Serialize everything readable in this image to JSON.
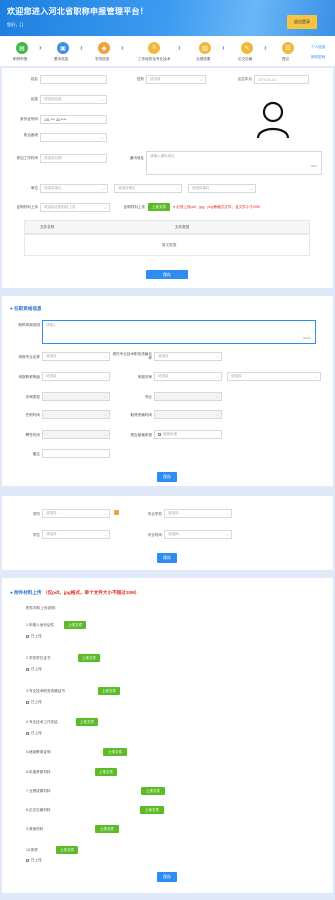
{
  "header": {
    "title": "欢迎您进入河北省职称申报管理平台！",
    "user": "您好，[ ]",
    "button": "退出登录"
  },
  "steps": [
    {
      "label": "职称申报",
      "icon": "doc-icon",
      "color": "#46b54a"
    },
    {
      "label": "基本信息",
      "icon": "user-card-icon",
      "color": "#3f8fe8"
    },
    {
      "label": "学历信息",
      "icon": "education-icon",
      "color": "#f0a23a"
    },
    {
      "label": "工作经历及专业技术",
      "icon": "list-icon",
      "color": "#f0b93a"
    },
    {
      "label": "业绩成果",
      "icon": "chart-icon",
      "color": "#f0b93a"
    },
    {
      "label": "论文论著",
      "icon": "book-icon",
      "color": "#f0b93a"
    },
    {
      "label": "提交",
      "icon": "submit-icon",
      "color": "#f0b93a"
    }
  ],
  "side_links": [
    "个人信息",
    "修改密码"
  ],
  "basic": {
    "name_label": "姓名",
    "name_value": "",
    "gender_label": "性别",
    "gender_value": "请选择",
    "birth_label": "出生年月",
    "birth_value": "1970-01-01",
    "nation_label": "民族",
    "nation_value": "请选择民族",
    "idcard_label": "身份证号码",
    "idcard_value": "131 *** 2A ****",
    "politics_label": "政治面貌",
    "politics_value": "",
    "firstwork_label": "参加工作时间",
    "firstwork_value": "请选择日期",
    "address_label": "通讯地址",
    "address_value": "请输入通讯地址",
    "address_count": "0/50",
    "unit_label": "单位",
    "unit_options": [
      "请选择单位",
      "请选择单位",
      "请选择单位"
    ],
    "region_label": "证明材料上传",
    "region_value": "请选择证明材料上传",
    "upload_label": "证明材料上传",
    "upload_btn": "上传文件",
    "upload_note": "必须上传pdf、jpg、png等格式文件，且文件小于20M",
    "table_headers": [
      "文件名称",
      "文件类型"
    ],
    "table_empty": "暂无数据",
    "save": "保存"
  },
  "job": {
    "title": "任职资格信息",
    "desc_label": "职称申报说明",
    "desc_placeholder": "请输入",
    "desc_count": "0/200",
    "fields": [
      {
        "label": "申报专业名称",
        "value": "请选择"
      },
      {
        "label": "现任专业技术职务资格名称",
        "value": "请选择"
      },
      {
        "label": "申报职称等级",
        "value": "请选择"
      },
      {
        "label": "申报评审",
        "value": "请选择"
      },
      {
        "label": "评审组织",
        "value": "请选择"
      },
      {
        "label": "评审类型",
        "value": ""
      },
      {
        "label": "专业",
        "value": ""
      },
      {
        "label": "任职时间",
        "value": ""
      },
      {
        "label": "取得资格时间",
        "value": ""
      },
      {
        "label": "聘任时间",
        "value": ""
      },
      {
        "label": "任职年限",
        "value": ""
      },
      {
        "label": "是否破格申报",
        "value": "破格申报"
      },
      {
        "label": "备注",
        "value": ""
      }
    ],
    "save": "保存"
  },
  "edu": {
    "fields": [
      {
        "label": "学历",
        "value": "请选择"
      },
      {
        "label": "毕业学校",
        "value": "请选择"
      },
      {
        "label": "学位",
        "value": "请选择"
      },
      {
        "label": "毕业时间",
        "value": "请选择"
      }
    ],
    "save": "保存"
  },
  "attach": {
    "title": "附件材料上传",
    "note": "（仅pdf、jpg格式，单个文件大小不超过10M）",
    "intro": "附件材料上传说明：",
    "items": [
      {
        "label": "1.申报人身份证件",
        "btn": "上传文件",
        "check": "已上传",
        "check2": ""
      },
      {
        "label": "2.学历学位证书",
        "btn": "上传文件",
        "check": "已上传",
        "check2": ""
      },
      {
        "label": "3.专业技术职务资格证书",
        "btn": "上传文件",
        "check": "已上传",
        "check2": ""
      },
      {
        "label": "4.专业技术工作总结",
        "btn": "上传文件",
        "check": "已上传",
        "check2": ""
      },
      {
        "label": "5.继续教育证明",
        "btn": "上传文件",
        "check": "",
        "check2": ""
      },
      {
        "label": "6.年度考核材料",
        "btn": "上传文件",
        "check": "",
        "check2": ""
      },
      {
        "label": "7.业绩成果材料",
        "btn": "上传文件",
        "check": "",
        "check2": ""
      },
      {
        "label": "8.论文论著材料",
        "btn": "上传文件",
        "check": "",
        "check2": ""
      },
      {
        "label": "9.其他材料",
        "btn": "上传文件",
        "check": "",
        "check2": ""
      },
      {
        "label": "10.附件",
        "btn": "上传文件",
        "check": "已上传",
        "check2": ""
      }
    ],
    "save": "保存"
  }
}
